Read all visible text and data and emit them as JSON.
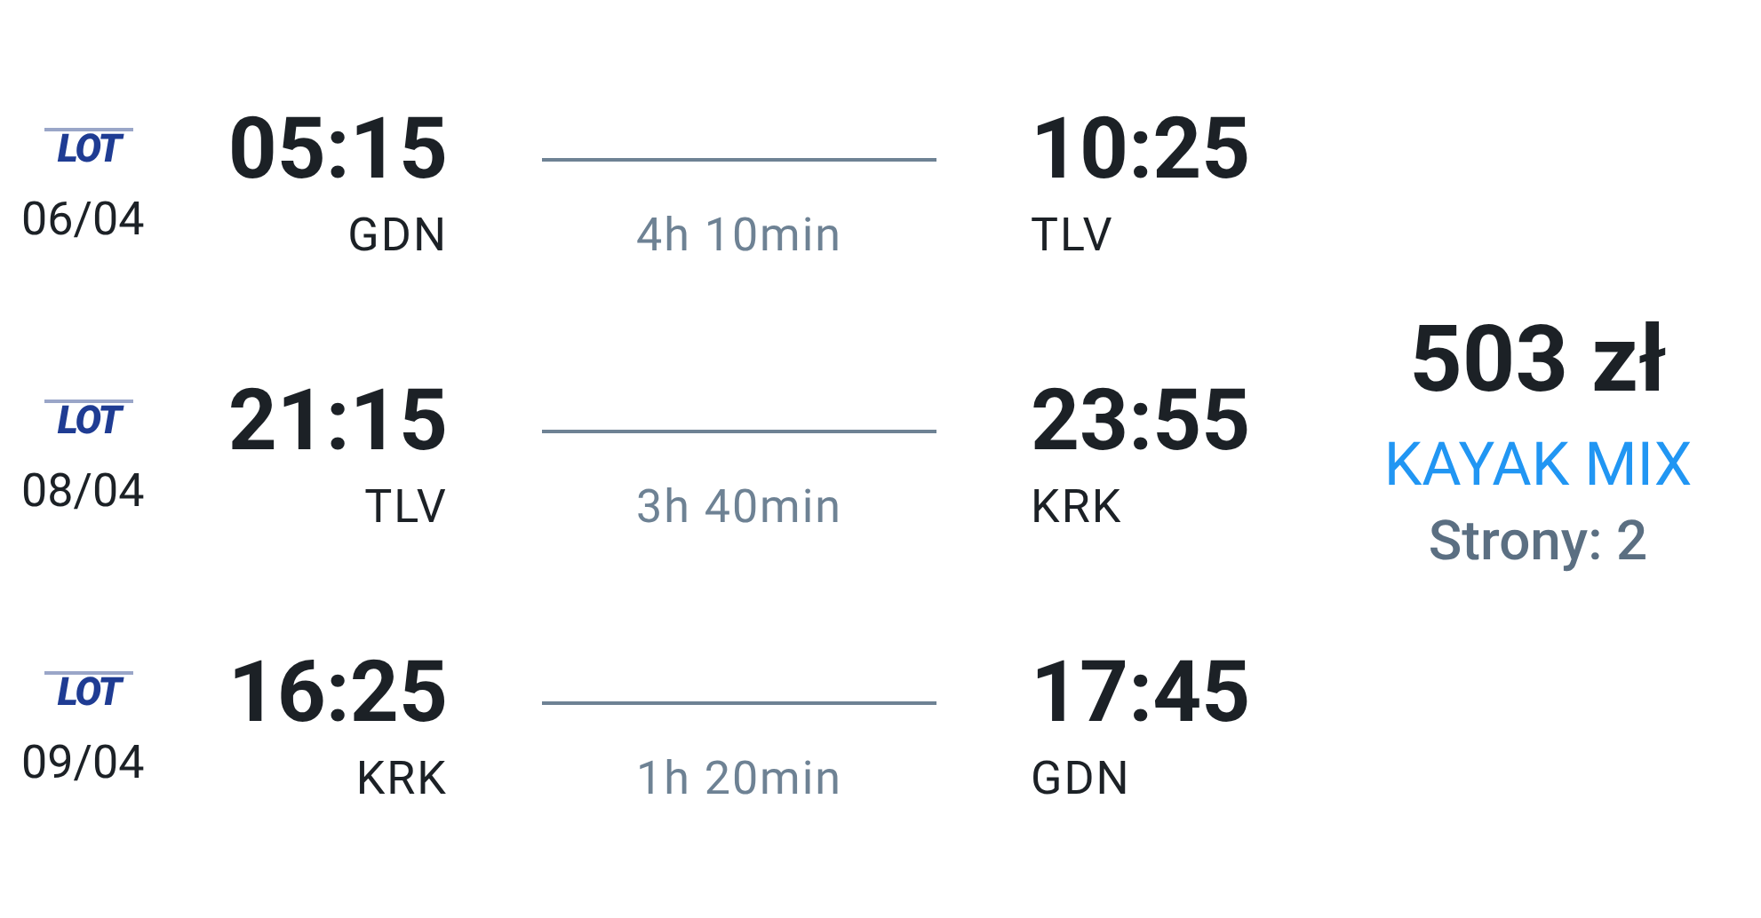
{
  "legs": [
    {
      "airline": "LOT",
      "date": "06/04",
      "depart_time": "05:15",
      "depart_airport": "GDN",
      "duration": "4h 10min",
      "arrive_time": "10:25",
      "arrive_airport": "TLV"
    },
    {
      "airline": "LOT",
      "date": "08/04",
      "depart_time": "21:15",
      "depart_airport": "TLV",
      "duration": "3h 40min",
      "arrive_time": "23:55",
      "arrive_airport": "KRK"
    },
    {
      "airline": "LOT",
      "date": "09/04",
      "depart_time": "16:25",
      "depart_airport": "KRK",
      "duration": "1h 20min",
      "arrive_time": "17:45",
      "arrive_airport": "GDN"
    }
  ],
  "price": {
    "amount": "503 zł",
    "provider": "KAYAK MIX",
    "sites": "Strony: 2"
  }
}
